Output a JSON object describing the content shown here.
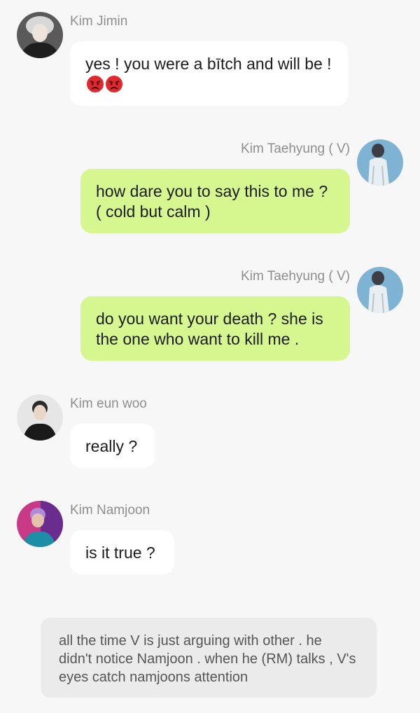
{
  "messages": [
    {
      "sender": "Kim Jimin",
      "avatar": "avatar-jimin",
      "side": "left",
      "text": "yes ! you were a bītch and will be !",
      "emojis": [
        "angry-face-icon",
        "angry-face-icon"
      ]
    },
    {
      "sender": "Kim Taehyung ( V)",
      "avatar": "avatar-taehyung",
      "side": "right",
      "text": "how dare you to say this to me ? ( cold but calm )"
    },
    {
      "sender": "Kim Taehyung ( V)",
      "avatar": "avatar-taehyung",
      "side": "right",
      "text": "do you want your death ? she is the one who want to kill me ."
    },
    {
      "sender": "Kim eun woo",
      "avatar": "avatar-eunwoo",
      "side": "left",
      "text": "really ?"
    },
    {
      "sender": "Kim Namjoon",
      "avatar": "avatar-namjoon",
      "side": "left",
      "text": "is it true ?"
    }
  ],
  "narration": "all the time V is just arguing with other . he didn't notice Namjoon . when he (RM) talks , V's eyes catch namjoons attention",
  "colors": {
    "background": "#f7f7f7",
    "incoming_bubble": "#ffffff",
    "outgoing_bubble": "#d6f68f",
    "narration_bubble": "#ebebeb",
    "name_text": "#8e8e8e"
  }
}
